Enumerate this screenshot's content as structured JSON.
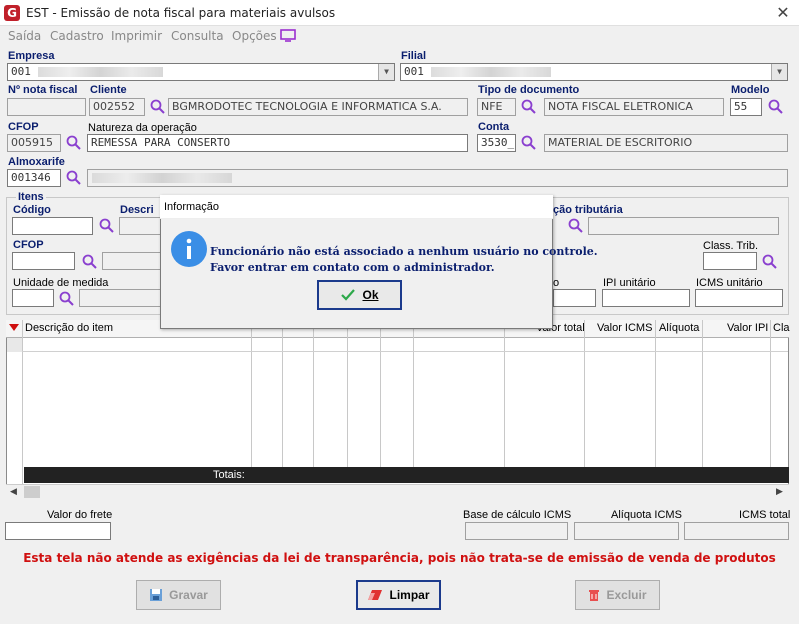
{
  "window": {
    "logo_letter": "G",
    "title": "EST - Emissão de nota fiscal para materiais avulsos",
    "close_glyph": "✕"
  },
  "menu": {
    "items": [
      "Saída",
      "Cadastro",
      "Imprimir",
      "Consulta",
      "Opções"
    ]
  },
  "empresa": {
    "label": "Empresa",
    "value": "001"
  },
  "filial": {
    "label": "Filial",
    "value": "001"
  },
  "nota": {
    "label": "Nº nota fiscal",
    "value": ""
  },
  "cliente": {
    "label": "Cliente",
    "code": "002552",
    "name": "BGMRODOTEC TECNOLOGIA E INFORMATICA S.A."
  },
  "tipo_documento": {
    "label": "Tipo de documento",
    "code": "NFE",
    "name": "NOTA FISCAL ELETRONICA"
  },
  "modelo": {
    "label": "Modelo",
    "value": "55"
  },
  "cfop": {
    "label": "CFOP",
    "value": "005915"
  },
  "natureza": {
    "label": "Natureza da operação",
    "value": "REMESSA PARA CONSERTO"
  },
  "conta": {
    "label": "Conta",
    "code": "3530_",
    "name": "MATERIAL DE ESCRITORIO"
  },
  "almoxarife": {
    "label": "Almoxarife",
    "code": "001346"
  },
  "itens": {
    "group_label": "Itens",
    "codigo_label": "Código",
    "descricao_label": "Descri",
    "situacao_label": "ção tributária",
    "cfop_label": "CFOP",
    "class_trib_label": "Class. Trib.",
    "unidade_label": "Unidade de medida",
    "o_label": "o",
    "ipi_unit_label": "IPI unitário",
    "icms_unit_label": "ICMS unitário"
  },
  "grid": {
    "columns": [
      "Descrição do item",
      "Valor total",
      "Valor ICMS",
      "Alíquota",
      "Valor IPI",
      "Cla"
    ],
    "totals_label": "Totais:"
  },
  "footer": {
    "frete_label": "Valor do frete",
    "base_icms_label": "Base de cálculo ICMS",
    "aliquota_label": "Alíquota ICMS",
    "icms_total_label": "ICMS total"
  },
  "warning": "Esta tela não atende as exigências da lei de transparência, pois não trata-se de emissão de venda de produtos",
  "buttons": {
    "gravar": "Gravar",
    "limpar": "Limpar",
    "excluir": "Excluir"
  },
  "dialog": {
    "title": "Informação",
    "line1": "Funcionário não está associado a nenhum usuário no controle.",
    "line2": "Favor entrar em contato com o administrador.",
    "ok_label": "Ok"
  },
  "colors": {
    "accent_blue": "#0a1e6e",
    "warning_red": "#d01010",
    "search_purple": "#8a3fcf",
    "info_blue": "#3a8ee6"
  }
}
